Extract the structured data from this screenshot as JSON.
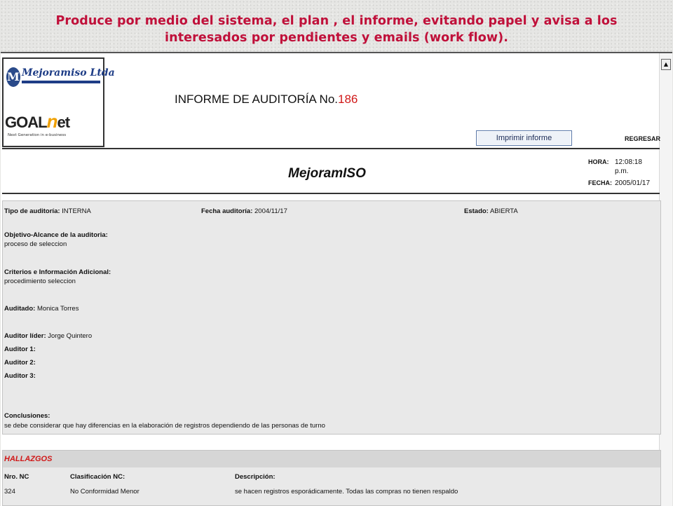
{
  "caption": {
    "line1": "Produce por medio del sistema, el plan , el informe, evitando papel y avisa a los",
    "line2": "interesados por pendientes  y emails (work flow)."
  },
  "logo": {
    "company": "Mejoramiso Ltda",
    "product_prefix": "GOAL",
    "product_accent": "n",
    "product_suffix": "et",
    "product_tagline": "Next Generation in e-business"
  },
  "header": {
    "title_prefix": "INFORME DE AUDITORÍA No.",
    "title_number": "186",
    "print_button": "Imprimir informe",
    "back_link": "REGRESAR",
    "brand": "MejoramISO",
    "hora_label": "HORA:",
    "hora_value_1": "12:08:18",
    "hora_value_2": "p.m.",
    "fecha_label": "FECHA:",
    "fecha_value": "2005/01/17"
  },
  "audit": {
    "tipo_label": "Tipo de auditoría:",
    "tipo_value": "INTERNA",
    "fecha_label": "Fecha auditoría:",
    "fecha_value": "2004/11/17",
    "estado_label": "Estado:",
    "estado_value": "ABIERTA",
    "objetivo_label": "Objetivo-Alcance de la auditoria:",
    "objetivo_value": "proceso de seleccion",
    "criterios_label": "Criterios e Información Adicional:",
    "criterios_value": "procedimiento seleccion",
    "auditado_label": "Auditado:",
    "auditado_value": "Monica Torres",
    "lider_label": "Auditor líder:",
    "lider_value": "Jorge Quintero",
    "auditor1_label": "Auditor 1:",
    "auditor2_label": "Auditor 2:",
    "auditor3_label": "Auditor 3:",
    "conclusiones_label": "Conclusiones:",
    "conclusiones_value": "se debe considerar que hay diferencias en la elaboración de registros dependiendo de las personas de turno"
  },
  "hallazgos": {
    "title": "HALLAZGOS",
    "columns": [
      "Nro. NC",
      "Clasificación NC:",
      "Descripción:"
    ],
    "rows": [
      [
        "324",
        "No Conformidad Menor",
        "se hacen registros esporádicamente. Todas las compras no tienen respaldo"
      ]
    ]
  },
  "icons": {
    "scroll_up": "scroll-up-arrow-icon"
  }
}
